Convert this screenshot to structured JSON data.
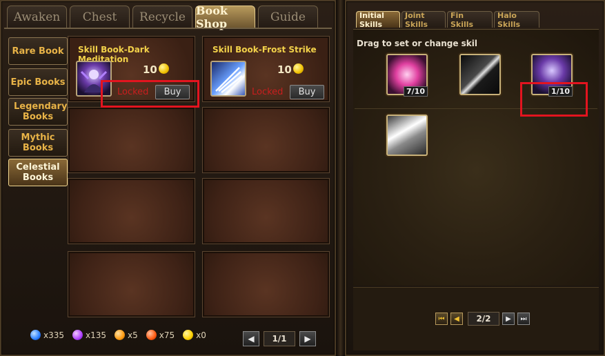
{
  "top_tabs": [
    "Awaken",
    "Chest",
    "Recycle",
    "Book Shop",
    "Guide"
  ],
  "active_top_tab": "Book Shop",
  "categories": [
    {
      "label": "Rare Book",
      "active": false
    },
    {
      "label": "Epic Books",
      "active": false
    },
    {
      "label": "Legendary Books",
      "active": false
    },
    {
      "label": "Mythic Books",
      "active": false
    },
    {
      "label": "Celestial Books",
      "active": true
    }
  ],
  "books": [
    {
      "title": "Skill Book-Dark Meditation",
      "price": "10",
      "status": "Locked",
      "buy_label": "Buy",
      "icon": "dark-meditation-icon"
    },
    {
      "title": "Skill Book-Frost Strike",
      "price": "10",
      "status": "Locked",
      "buy_label": "Buy",
      "icon": "frost-strike-icon"
    }
  ],
  "currencies": [
    {
      "icon": "blue-gem-icon",
      "color": "#2a7fff",
      "count": "x335"
    },
    {
      "icon": "purple-gem-icon",
      "color": "#b040ff",
      "count": "x135"
    },
    {
      "icon": "orange-gem-icon",
      "color": "#ff9a10",
      "count": "x5"
    },
    {
      "icon": "red-gem-icon",
      "color": "#ff5a10",
      "count": "x75"
    },
    {
      "icon": "gold-gem-icon",
      "color": "#ffd000",
      "count": "x0"
    }
  ],
  "left_pager": {
    "page": "1/1"
  },
  "skill_tabs": [
    "Initial Skills",
    "Joint Skills",
    "Fin Skills",
    "Halo Skills"
  ],
  "active_skill_tab": "Initial Skills",
  "hint": "Drag to set or change skil",
  "skills": [
    {
      "icon": "pink-orb-skill-icon",
      "level": "7/10"
    },
    {
      "icon": "black-slash-skill-icon",
      "level": ""
    },
    {
      "icon": "dark-meditation-skill-icon",
      "level": "1/10"
    },
    {
      "icon": "silver-shards-skill-icon",
      "level": ""
    }
  ],
  "right_pager": {
    "page": "2/2"
  },
  "colors": {
    "accent_gold": "#f3d24a",
    "locked_red": "#c81e1e",
    "highlight_red": "#e3141f"
  }
}
